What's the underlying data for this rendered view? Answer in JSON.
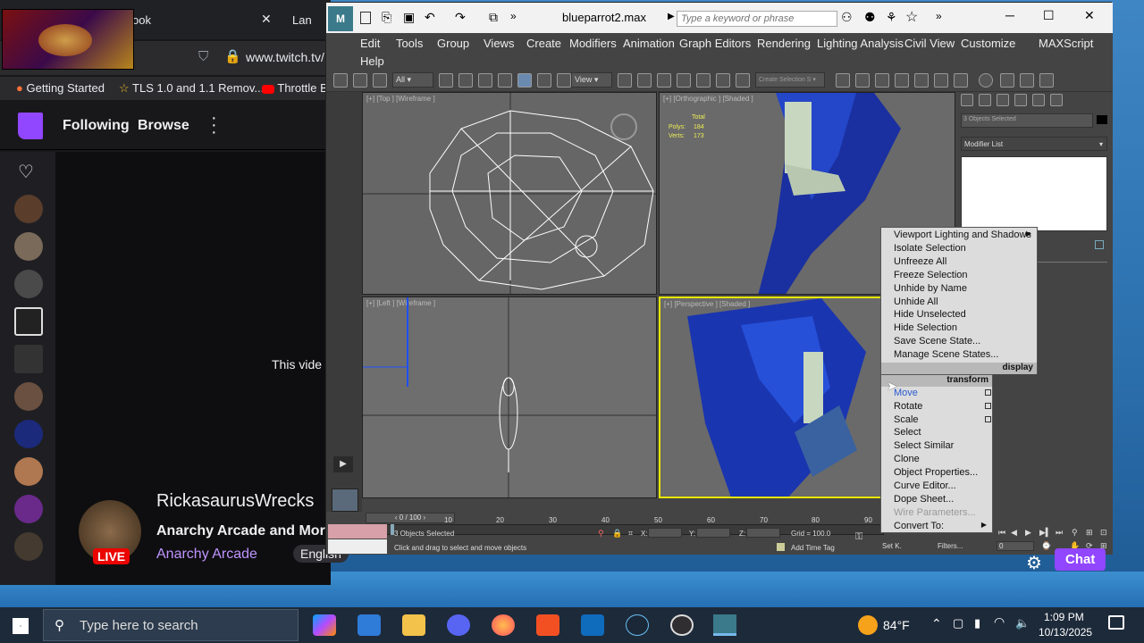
{
  "browser": {
    "tab1_label": "ook",
    "tab2_label": "Lan Par",
    "url": "www.twitch.tv/",
    "bookmarks": [
      "Getting Started",
      "TLS 1.0 and 1.1 Remov...",
      "Throttle B"
    ],
    "nav": {
      "following": "Following",
      "browse": "Browse"
    },
    "video_text": "This vide",
    "streamer": "RickasaurusWrecks",
    "stream_title": "Anarchy Arcade and Mor",
    "category": "Anarchy Arcade",
    "language": "English",
    "live_badge": "LIVE",
    "chat_button": "Chat"
  },
  "max": {
    "file_title": "blueparrot2.max",
    "search_placeholder": "Type a keyword or phrase",
    "menu": [
      "Edit",
      "Tools",
      "Group",
      "Views",
      "Create",
      "Modifiers",
      "Animation",
      "Graph Editors",
      "Rendering",
      "Lighting Analysis",
      "Civil View",
      "Customize",
      "MAXScript",
      "Help"
    ],
    "toolbar": {
      "selection_filter": "All",
      "ref_coord": "View",
      "named_selection": "Create Selection S"
    },
    "viewports": {
      "top": "[+] [Top ] [Wireframe ]",
      "ortho": "[+] [Orthographic ] [Shaded ]",
      "left": "[+] [Left ] [Wireframe ]",
      "persp": "[+] [Perspective ] [Shaded ]"
    },
    "stats": {
      "total_label": "Total",
      "polys_label": "Polys:",
      "polys_value": "184",
      "verts_label": "Verts:",
      "verts_value": "173"
    },
    "command_panel": {
      "selection_field": "3 Objects Selected",
      "modifier_list": "Modifier List"
    },
    "timeline": {
      "frame_display": "0 / 100",
      "ticks": [
        "10",
        "20",
        "30",
        "40",
        "50",
        "60",
        "70",
        "80",
        "90"
      ]
    },
    "status": {
      "selected": "3 Objects Selected",
      "prompt": "Click and drag to select and move objects",
      "x_label": "X:",
      "y_label": "Y:",
      "z_label": "Z:",
      "grid": "Grid = 100.0",
      "add_time_tag": "Add Time Tag",
      "set_key": "Set K.",
      "filters": "Filters...",
      "frame_field": "0"
    }
  },
  "quad_menu": {
    "display_items": [
      "Viewport Lighting and Shadows",
      "Isolate Selection",
      "Unfreeze All",
      "Freeze Selection",
      "Unhide by Name",
      "Unhide All",
      "Hide Unselected",
      "Hide Selection",
      "Save Scene State...",
      "Manage Scene States..."
    ],
    "display_header": "display",
    "transform_header": "transform",
    "transform_items": [
      "Move",
      "Rotate",
      "Scale",
      "Select",
      "Select Similar",
      "Clone",
      "Object Properties...",
      "Curve Editor...",
      "Dope Sheet...",
      "Wire Parameters...",
      "Convert To:"
    ]
  },
  "taskbar": {
    "search_placeholder": "Type here to search",
    "weather": "84°F",
    "time": "1:09 PM",
    "date": "10/13/2025"
  },
  "colors": {
    "twitch_purple": "#9146ff",
    "live_red": "#eb0400",
    "viewport_active": "#e6e600",
    "desktop_blue": "#2b6fad"
  }
}
